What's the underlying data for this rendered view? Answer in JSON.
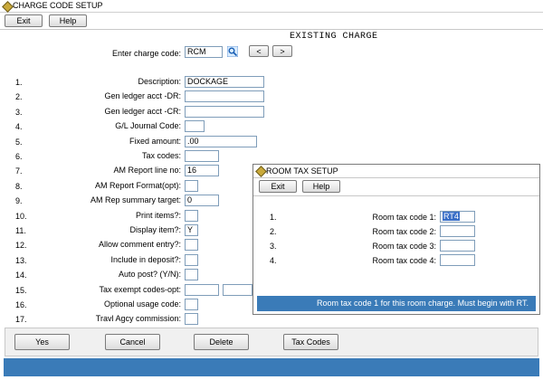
{
  "window": {
    "title": "CHARGE CODE SETUP"
  },
  "toolbar": {
    "exit_label": "Exit",
    "help_label": "Help"
  },
  "heading": "EXISTING CHARGE",
  "charge_code": {
    "label": "Enter charge code:",
    "value": "RCM",
    "prev": "<",
    "next": ">"
  },
  "form": [
    {
      "num": "1.",
      "label": "Description:",
      "value": "DOCKAGE"
    },
    {
      "num": "2.",
      "label": "Gen ledger acct -DR:",
      "value": ""
    },
    {
      "num": "3.",
      "label": "Gen ledger acct -CR:",
      "value": ""
    },
    {
      "num": "4.",
      "label": "G/L Journal Code:",
      "value": ""
    },
    {
      "num": "5.",
      "label": "Fixed amount:",
      "value": ".00"
    },
    {
      "num": "6.",
      "label": "Tax codes:",
      "value": ""
    },
    {
      "num": "7.",
      "label": "AM Report line no:",
      "value": "16"
    },
    {
      "num": "8.",
      "label": "AM Report Format(opt):",
      "value": ""
    },
    {
      "num": "9.",
      "label": "AM Rep summary target:",
      "value": "0"
    },
    {
      "num": "10.",
      "label": "Print items?:",
      "value": ""
    },
    {
      "num": "11.",
      "label": "Display item?:",
      "value": "Y"
    },
    {
      "num": "12.",
      "label": "Allow comment entry?:",
      "value": ""
    },
    {
      "num": "13.",
      "label": "Include in deposit?:",
      "value": ""
    },
    {
      "num": "14.",
      "label": "Auto post? (Y/N):",
      "value": ""
    },
    {
      "num": "15.",
      "label": "Tax exempt codes-opt:",
      "value": ""
    },
    {
      "num": "16.",
      "label": "Optional usage code:",
      "value": ""
    },
    {
      "num": "17.",
      "label": "Travl Agcy commission:",
      "value": ""
    }
  ],
  "dialog": {
    "title": "ROOM TAX SETUP",
    "exit_label": "Exit",
    "help_label": "Help",
    "rows": [
      {
        "num": "1.",
        "label": "Room tax code 1:",
        "value": "RT4"
      },
      {
        "num": "2.",
        "label": "Room tax code 2:",
        "value": ""
      },
      {
        "num": "3.",
        "label": "Room tax code 3:",
        "value": ""
      },
      {
        "num": "4.",
        "label": "Room tax code 4:",
        "value": ""
      }
    ],
    "status": "Room tax code 1 for this room charge.  Must begin with RT."
  },
  "actions": {
    "yes": "Yes",
    "cancel": "Cancel",
    "delete": "Delete",
    "tax_codes": "Tax Codes"
  },
  "colors": {
    "status_bar": "#3a7bb8",
    "field_border": "#7f9db9"
  }
}
